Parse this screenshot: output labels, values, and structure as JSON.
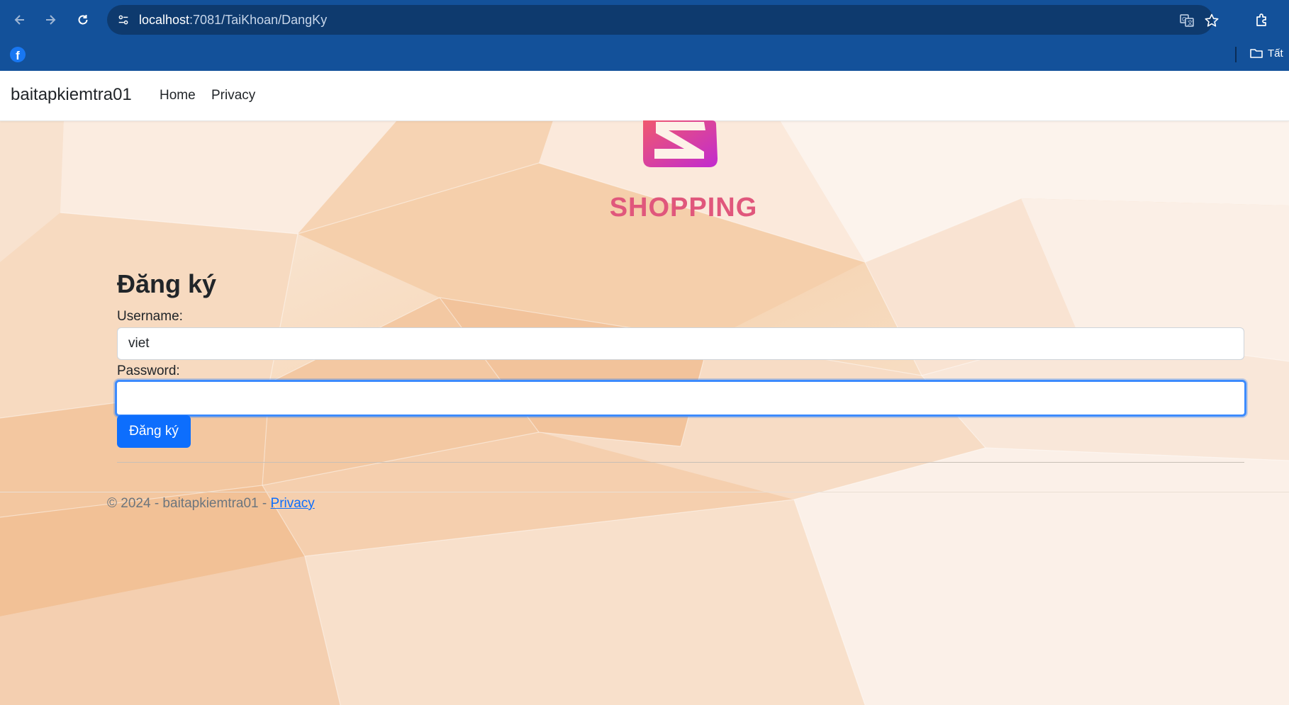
{
  "browser": {
    "url_host": "localhost",
    "url_path": ":7081/TaiKhoan/DangKy",
    "bookmark_folder_label": "Tất",
    "icons": [
      "back-arrow-icon",
      "forward-arrow-icon",
      "reload-icon",
      "site-info-icon",
      "translate-icon",
      "star-icon",
      "extensions-icon",
      "facebook-icon",
      "folder-icon"
    ],
    "chrome_color": "#13519a"
  },
  "navbar": {
    "brand": "baitapkiemtra01",
    "links": [
      "Home",
      "Privacy"
    ]
  },
  "logo": {
    "text": "SHOPPING"
  },
  "form": {
    "title": "Đăng ký",
    "username_label": "Username:",
    "username_value": "viet",
    "password_label": "Password:",
    "password_value": "",
    "submit_label": "Đăng ký"
  },
  "footer": {
    "copyright": "© 2024 - baitapkiemtra01 - ",
    "privacy_link": "Privacy"
  },
  "colors": {
    "primary": "#0d6efd",
    "logo_gradient_start": "#f0596e",
    "logo_gradient_end": "#c12ad0"
  }
}
